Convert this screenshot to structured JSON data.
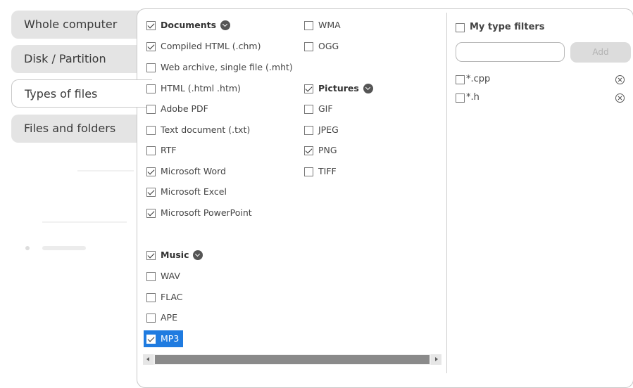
{
  "nav": {
    "items": [
      {
        "label": "Whole computer"
      },
      {
        "label": "Disk / Partition"
      },
      {
        "label": "Types of files"
      },
      {
        "label": "Files and folders"
      }
    ]
  },
  "documents": {
    "group_label": "Documents",
    "items": [
      {
        "label": "Compiled HTML (.chm)"
      },
      {
        "label": "Web archive, single file (.mht)"
      },
      {
        "label": "HTML (.html .htm)"
      },
      {
        "label": "Adobe PDF"
      },
      {
        "label": "Text document (.txt)"
      },
      {
        "label": "RTF"
      },
      {
        "label": "Microsoft Word"
      },
      {
        "label": "Microsoft Excel"
      },
      {
        "label": "Microsoft PowerPoint"
      }
    ]
  },
  "music": {
    "group_label": "Music",
    "items": [
      {
        "label": "WAV"
      },
      {
        "label": "FLAC"
      },
      {
        "label": "APE"
      },
      {
        "label": "MP3"
      },
      {
        "label": "WMA"
      },
      {
        "label": "OGG"
      }
    ]
  },
  "pictures": {
    "group_label": "Pictures",
    "items": [
      {
        "label": "GIF"
      },
      {
        "label": "JPEG"
      },
      {
        "label": "PNG"
      },
      {
        "label": "TIFF"
      }
    ]
  },
  "custom_filters": {
    "title": "My type filters",
    "input_value": "",
    "add_label": "Add",
    "items": [
      {
        "label": "*.cpp"
      },
      {
        "label": "*.h"
      }
    ]
  }
}
